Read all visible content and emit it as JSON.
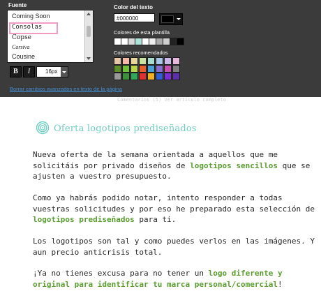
{
  "toolbar": {
    "font_label": "Fuente",
    "fonts": [
      "Coming Soon",
      "Consolas",
      "Copse",
      "Corsiva",
      "Cousine"
    ],
    "selected_font": "Consolas",
    "bold_label": "B",
    "italic_label": "I",
    "font_size": "16px",
    "reset_link": "Borrar cambios avanzados en texto de la página",
    "text_color_label": "Color del texto",
    "text_color_value": "#000000",
    "template_colors_label": "Colores de esta plantilla",
    "template_colors": [
      "#ffffff",
      "#ffffff",
      "#d9d9d9",
      "#aee3da",
      "#ffffff",
      "#eeeeee",
      "#aaaaaa",
      "#cfcfcf",
      "#222222",
      "#000000"
    ],
    "recommended_label": "Colores recomendados",
    "recommended_colors": [
      [
        "#e7c6a8",
        "#f3b8a8",
        "#e8d79a",
        "#c9e3a0",
        "#a8dccf",
        "#a8c7e8",
        "#c9b8e8",
        "#e8b8dc"
      ],
      [
        "#5d8f28",
        "#6fbf3a",
        "#b9d64a",
        "#e85d2a",
        "#4a9ed6",
        "#8a6dd0",
        "#c94fae",
        "#7f7f7f"
      ],
      [
        "#9a9a9a",
        "#3c8f3c",
        "#2fa85a",
        "#e02f2f",
        "#f0b020",
        "#2f5ed6",
        "#7a2fd6",
        "#5a2fa8"
      ]
    ]
  },
  "article": {
    "faded_line": "Comentarios (5) Ver articulo completo",
    "title": "Oferta logotipos prediseñados",
    "p1_a": "Nueva oferta de la semana orientada a aquellos que me solicitáis por privado diseños de ",
    "p1_b": "logotipos sencillos",
    "p1_c": " que se ajusten a vuestro presupuesto.",
    "p2_a": "Como ya habrás podido notar, intento responder a todas vuestras solicitudes y por eso he preparado esta selección de ",
    "p2_b": "logotipos prediseñados",
    "p2_c": " para ti.",
    "p3": "Los logotipos son tal y como puedes verlos en las imágenes. Y aun precio anticrisis total.",
    "p4_a": "¡Ya no tienes excusa para no tener un ",
    "p4_b": "logo diferente y original para identificar tu marca personal/comercial",
    "p4_c": "!"
  },
  "colors": {
    "toolbar_bg": "#3b3b3b",
    "title_teal": "#6fcfc3",
    "highlight_green": "#5a9e30",
    "link_blue": "#3f8fd8",
    "selection_pink": "#f29cc5"
  }
}
